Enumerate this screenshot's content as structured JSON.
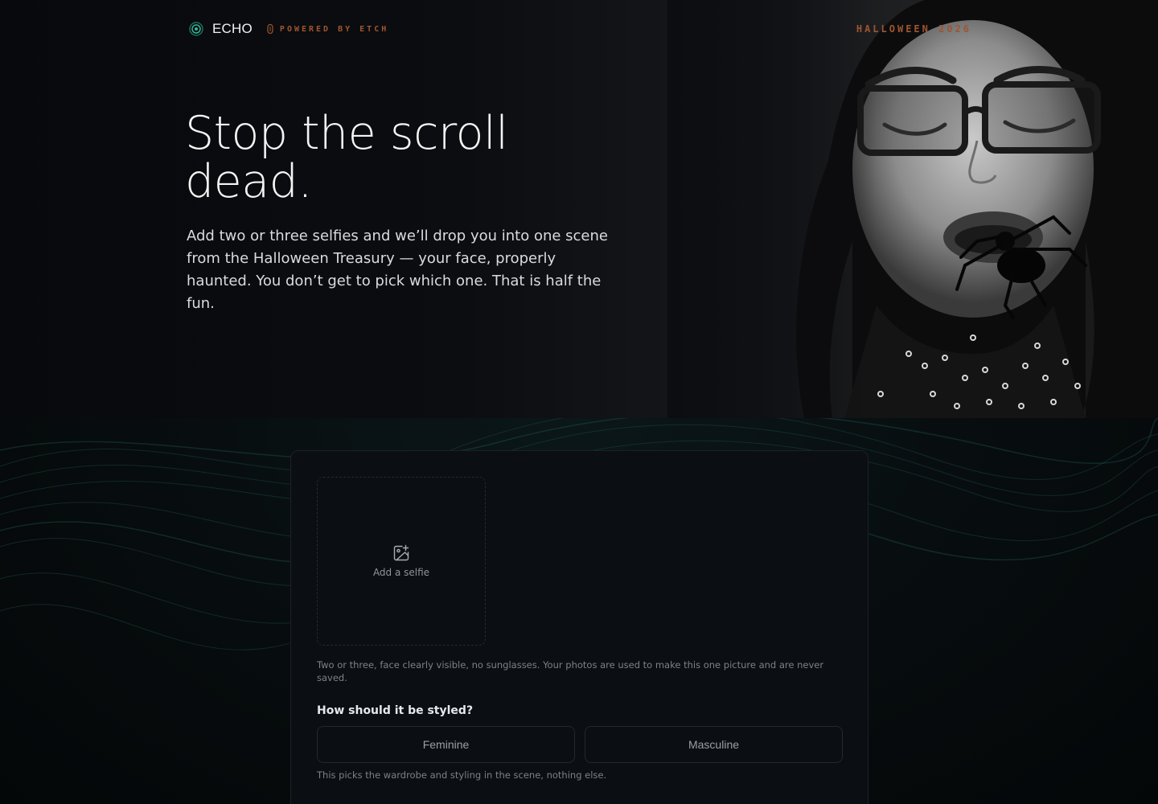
{
  "header": {
    "brand": "ECHO",
    "powered_by": "POWERED BY ETCH",
    "season": "HALLOWEEN 2026"
  },
  "hero": {
    "headline": "Stop the scroll dead.",
    "lede": "Add two or three selfies and we’ll drop you into one scene from the Halloween Treasury — your face, properly haunted. You don’t get to pick which one. That is half the fun."
  },
  "upload": {
    "add_label": "Add a selfie",
    "icon": "image-plus-icon",
    "helper": "Two or three, face clearly visible, no sunglasses. Your photos are used to make this one picture and are never saved."
  },
  "style": {
    "question": "How should it be styled?",
    "options": [
      "Feminine",
      "Masculine"
    ],
    "note": "This picks the wardrobe and styling in the scene, nothing else."
  },
  "colors": {
    "accent_orange": "#a1552e",
    "brand_teal": "#2fb79a",
    "background": "#07090c"
  }
}
